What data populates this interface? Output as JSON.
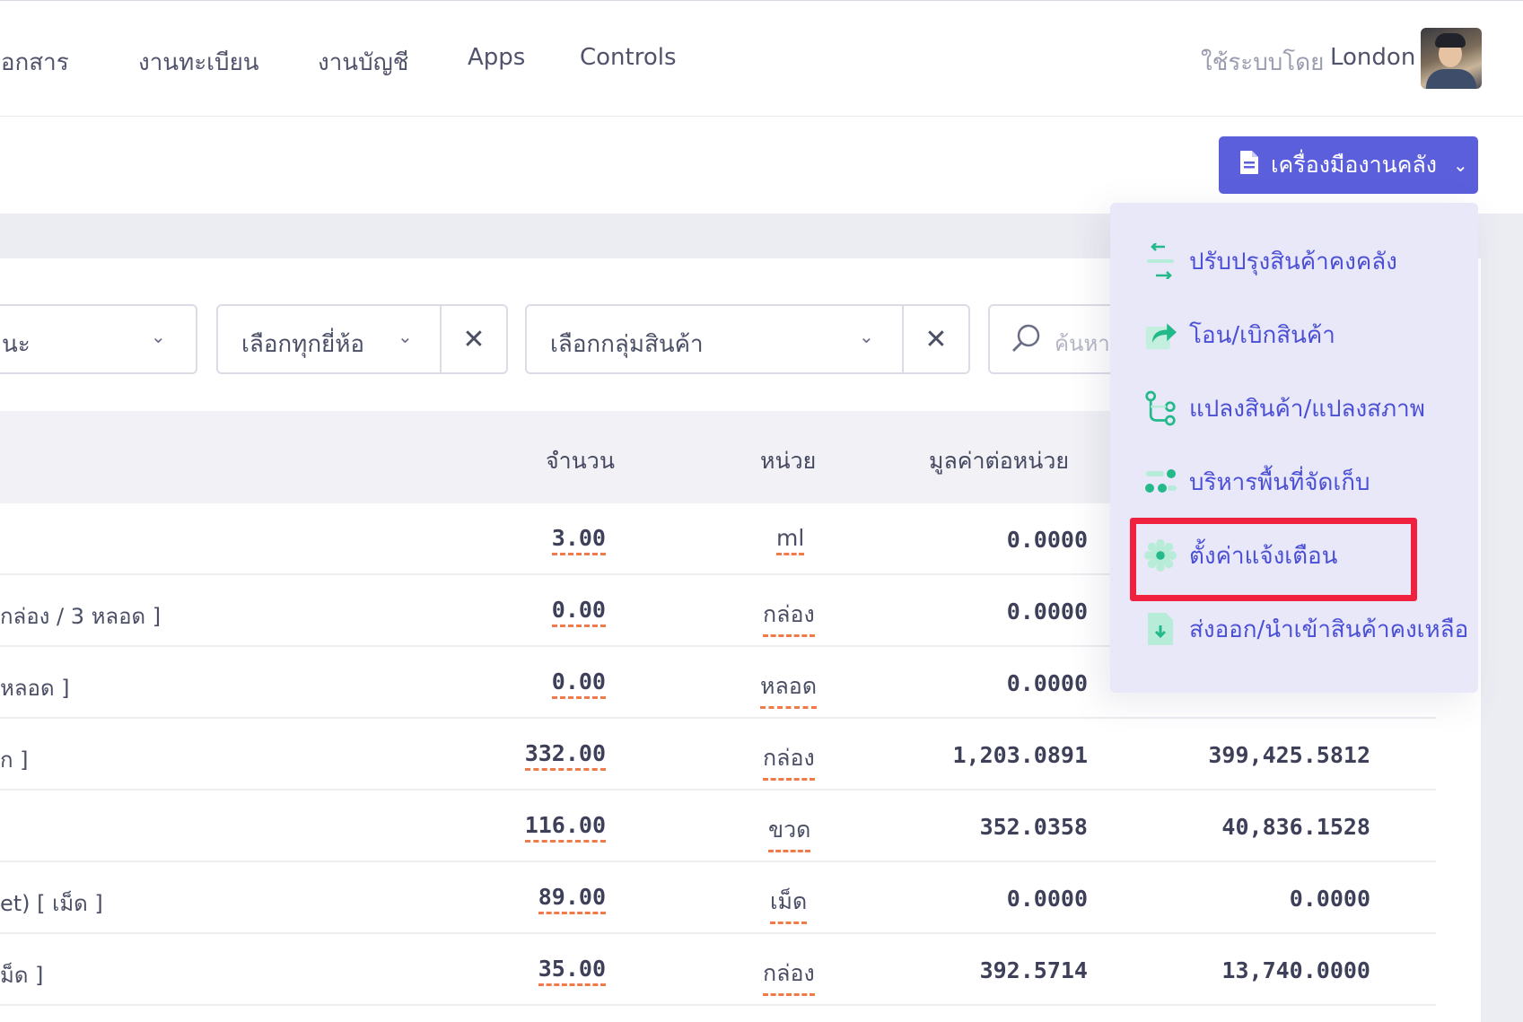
{
  "nav": {
    "items": [
      "เอกสาร",
      "งานทะเบียน",
      "งานบัญชี",
      "Apps",
      "Controls"
    ],
    "user_label": "ใช้ระบบโดย",
    "user_name": "London"
  },
  "toolbar": {
    "tools_button": "เครื่องมืองานคลัง"
  },
  "filters": {
    "status_value": "นะ",
    "brand_value": "เลือกทุกยี่ห้อ",
    "group_value": "เลือกกลุ่มสินค้า",
    "search_placeholder": "ค้นหา"
  },
  "table": {
    "headers": {
      "qty": "จำนวน",
      "unit": "หน่วย",
      "unit_value": "มูลค่าต่อหน่วย"
    },
    "rows": [
      {
        "name": "",
        "qty": "3.00",
        "unit": "ml",
        "unit_value": "0.0000",
        "total": ""
      },
      {
        "name": "กล่อง / 3 หลอด ]",
        "qty": "0.00",
        "unit": "กล่อง",
        "unit_value": "0.0000",
        "total": ""
      },
      {
        "name": "หลอด ]",
        "qty": "0.00",
        "unit": "หลอด",
        "unit_value": "0.0000",
        "total": ""
      },
      {
        "name": "ก ]",
        "qty": "332.00",
        "unit": "กล่อง",
        "unit_value": "1,203.0891",
        "total": "399,425.5812"
      },
      {
        "name": "",
        "qty": "116.00",
        "unit": "ขวด",
        "unit_value": "352.0358",
        "total": "40,836.1528"
      },
      {
        "name": "et) [ เม็ด ]",
        "qty": "89.00",
        "unit": "เม็ด",
        "unit_value": "0.0000",
        "total": "0.0000"
      },
      {
        "name": "ม็ด ]",
        "qty": "35.00",
        "unit": "กล่อง",
        "unit_value": "392.5714",
        "total": "13,740.0000"
      }
    ]
  },
  "dropdown": {
    "items": [
      {
        "label": "ปรับปรุงสินค้าคงคลัง",
        "icon": "adjust-arrows-icon"
      },
      {
        "label": "โอน/เบิกสินค้า",
        "icon": "share-arrow-icon"
      },
      {
        "label": "แปลงสินค้า/แปลงสภาพ",
        "icon": "git-branch-icon"
      },
      {
        "label": "บริหารพื้นที่จัดเก็บ",
        "icon": "storage-dots-icon"
      },
      {
        "label": "ตั้งค่าแจ้งเตือน",
        "icon": "settings-gear-icon"
      },
      {
        "label": "ส่งออก/นำเข้าสินค้าคงเหลือ",
        "icon": "file-download-icon"
      }
    ]
  },
  "colors": {
    "accent": "#5b5fdc",
    "menu_text": "#4a4fd6",
    "icon_green": "#23b98a",
    "highlight": "#f0213f",
    "underline": "#f07a4a"
  }
}
